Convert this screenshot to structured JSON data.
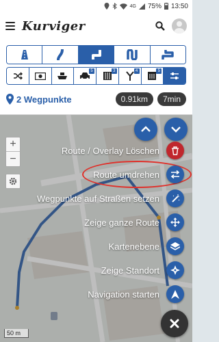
{
  "statusbar": {
    "signal": "4G",
    "battery": "75%",
    "time": "13:50"
  },
  "header": {
    "logo": "Kurviger"
  },
  "route_types": [
    {
      "icon": "highway-icon",
      "active": false
    },
    {
      "icon": "curvy-road-icon",
      "active": false
    },
    {
      "icon": "curvy-road-icon",
      "active": true
    },
    {
      "icon": "very-curvy-road-icon",
      "active": false
    },
    {
      "icon": "extremely-curvy-road-icon",
      "active": false
    }
  ],
  "options": [
    {
      "icon": "shuffle-icon",
      "badge": ""
    },
    {
      "icon": "toll-icon",
      "badge": ""
    },
    {
      "icon": "ferry-icon",
      "badge": ""
    },
    {
      "icon": "car-icon",
      "badge": "5"
    },
    {
      "icon": "unpaved-road-icon",
      "badge": "3"
    },
    {
      "icon": "fork-road-icon",
      "badge": "4"
    },
    {
      "icon": "dead-end-icon",
      "badge": "5"
    },
    {
      "icon": "sliders-icon",
      "badge": ""
    }
  ],
  "waypoints": {
    "label": "2 Wegpunkte",
    "distance": "0.91km",
    "duration": "7min"
  },
  "map": {
    "scale": "50 m",
    "zoom_in": "+",
    "zoom_out": "−"
  },
  "menu": {
    "items": [
      {
        "label": "Route / Overlay Löschen",
        "color": "#c0272d",
        "icon": "trash-icon"
      },
      {
        "label": "Route umdrehen",
        "color": "#2a5fa9",
        "icon": "swap-icon"
      },
      {
        "label": "Wegpunkte auf Straßen setzen",
        "color": "#2a5fa9",
        "icon": "magic-wand-icon"
      },
      {
        "label": "Zeige ganze Route",
        "color": "#2a5fa9",
        "icon": "move-arrows-icon"
      },
      {
        "label": "Kartenebene",
        "color": "#2a5fa9",
        "icon": "layers-icon"
      },
      {
        "label": "Zeige Standort",
        "color": "#2a5fa9",
        "icon": "locate-icon"
      },
      {
        "label": "Navigation starten",
        "color": "#2a5fa9",
        "icon": "navigation-arrow-icon"
      }
    ]
  },
  "colors": {
    "primary": "#2a5fa9",
    "danger": "#c0272d",
    "highlight": "#e0302a"
  }
}
